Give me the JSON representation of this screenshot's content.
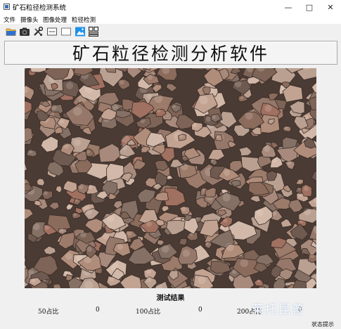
{
  "window": {
    "title": "矿石粒径检测系统"
  },
  "menu": {
    "items": [
      "文件",
      "摄像头",
      "图像处理",
      "粒径检测"
    ]
  },
  "toolbar": {
    "icons": [
      "open-folder-icon",
      "camera-icon",
      "tools-icon",
      "image-frame-icon",
      "blank-frame-icon",
      "picture-icon",
      "grid-layout-icon"
    ]
  },
  "banner": {
    "title": "矿石粒径检测分析软件"
  },
  "results": {
    "heading": "测试结果",
    "items": [
      {
        "label": "50占比",
        "value": "0"
      },
      {
        "label": "100占比",
        "value": "0"
      },
      {
        "label": "200占比",
        "value": "0"
      }
    ]
  },
  "watermark": "莱托昆普",
  "status": {
    "text": "状态提示"
  }
}
